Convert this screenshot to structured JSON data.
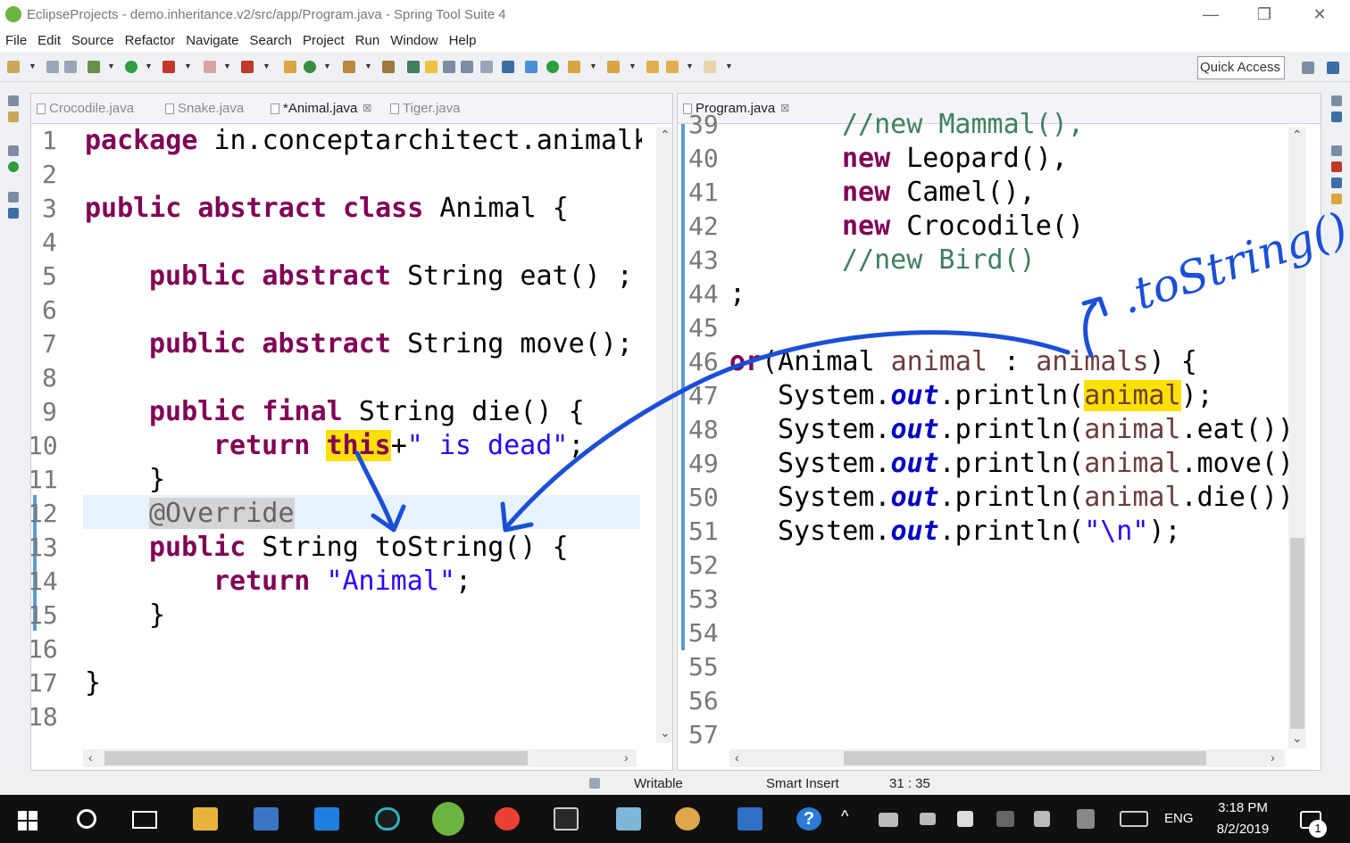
{
  "window": {
    "title": "EclipseProjects - demo.inheritance.v2/src/app/Program.java - Spring Tool Suite 4",
    "minimize": "—",
    "restore": "❐",
    "close": "✕"
  },
  "menu": [
    "File",
    "Edit",
    "Source",
    "Refactor",
    "Navigate",
    "Search",
    "Project",
    "Run",
    "Window",
    "Help"
  ],
  "toolbar": {
    "quick_access": "Quick Access"
  },
  "left_editor": {
    "tabs": [
      "Crocodile.java",
      "Snake.java",
      "*Animal.java",
      "Tiger.java"
    ],
    "active_tab": 2,
    "line_numbers": [
      "1",
      "2",
      "3",
      "4",
      "5",
      "6",
      "7",
      "8",
      "9",
      "10",
      "11",
      "12",
      "13",
      "14",
      "15",
      "16",
      "17",
      "18"
    ],
    "lines": {
      "l1_kw": "package",
      "l1_rest": " in.conceptarchitect.animalk",
      "l3_kw": "public abstract class",
      "l3_rest": " Animal {",
      "l5_kw": "public abstract",
      "l5_rest": " String eat() ;",
      "l7_kw": "public abstract",
      "l7_rest": " String move();",
      "l9_kw": "public final",
      "l9_rest": " String die() {",
      "l10_kw": "return",
      "l10_this": "this",
      "l10_op": "+",
      "l10_str": "\" is dead\"",
      "l10_end": ";",
      "l11": "}",
      "l12_ann": "@Override",
      "l13_kw": "public",
      "l13_rest": " String toString() {",
      "l14_kw": "return",
      "l14_str": "\"Animal\"",
      "l14_end": ";",
      "l15": "}",
      "l17": "}"
    }
  },
  "right_editor": {
    "tabs": [
      "Program.java"
    ],
    "line_numbers": [
      "39",
      "40",
      "41",
      "42",
      "43",
      "44",
      "45",
      "46",
      "47",
      "48",
      "49",
      "50",
      "51",
      "52",
      "53",
      "54",
      "55",
      "56",
      "57"
    ],
    "lines": {
      "l39": "//new Mammal(),",
      "l40_kw": "new",
      "l40_rest": " Leopard(),",
      "l41_kw": "new",
      "l41_rest": " Camel(),",
      "l42_kw": "new",
      "l42_rest": " Crocodile()",
      "l43": "//new Bird()",
      "l44": ";",
      "l46_kw": "or",
      "l46_a": "(Animal ",
      "l46_var": "animal",
      "l46_b": " : ",
      "l46_var2": "animals",
      "l46_c": ") {",
      "sys": "System.",
      "out": "out",
      "l47_a": ".println(",
      "l47_var": "animal",
      "l47_b": ");",
      "l48_a": ".println(",
      "l48_var": "animal",
      "l48_b": ".eat())",
      "l49_a": ".println(",
      "l49_var": "animal",
      "l49_b": ".move()",
      "l50_a": ".println(",
      "l50_var": "animal",
      "l50_b": ".die())",
      "l51_a": ".println(",
      "l51_str": "\"\\n\"",
      "l51_b": ");"
    }
  },
  "handwriting": ".toString()",
  "status": {
    "writable": "Writable",
    "insert_mode": "Smart Insert",
    "position": "31 : 35"
  },
  "taskbar": {
    "time": "3:18 PM",
    "date": "8/2/2019",
    "language": "ENG",
    "notifications": "1",
    "help": "?"
  },
  "colors": {
    "keyword": "#7f0055",
    "string": "#2a00ff",
    "comment": "#3f7f5f",
    "field": "#0000c0",
    "highlight": "#ffe000",
    "ink": "#1a4fd6"
  }
}
